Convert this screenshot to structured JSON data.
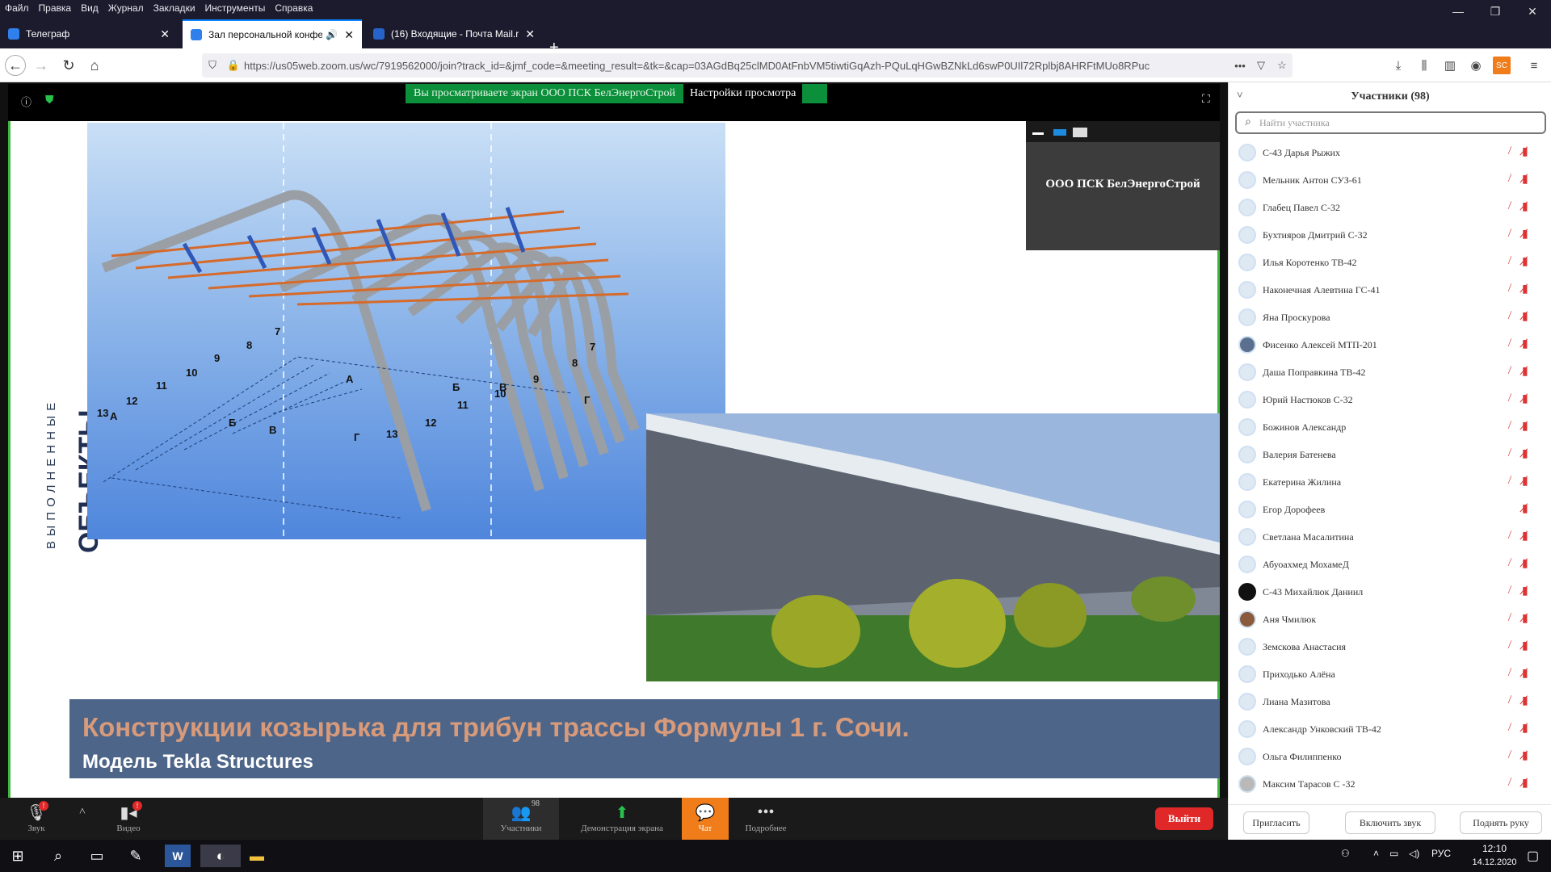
{
  "menu": [
    "Файл",
    "Правка",
    "Вид",
    "Журнал",
    "Закладки",
    "Инструменты",
    "Справка"
  ],
  "window_controls": {
    "minimize": "—",
    "maximize": "❐",
    "close": "✕"
  },
  "tabs": [
    {
      "label": "Телеграф",
      "favicon": "telegraph-icon"
    },
    {
      "label": "Зал персональной конфер",
      "favicon": "zoom-icon"
    },
    {
      "label": "(16) Входящие - Почта Mail.ru",
      "favicon": "mail-icon"
    }
  ],
  "new_tab": "+",
  "url": "https://us05web.zoom.us/wc/7919562000/join?track_id=&jmf_code=&meeting_result=&tk=&cap=03AGdBq25clMD0AtFnbVM5tiwtiGqAzh-PQuLqHGwBZNkLd6swP0UIl72Rplbj8AHRFtMUo8RPuc",
  "url_more": "•••",
  "meeting": {
    "share_banner": "Вы просматриваете экран ООО ПСК БелЭнергоСтрой",
    "view_settings": "Настройки просмотра",
    "presenter": "ООО ПСК БелЭнергоСтрой",
    "slide": {
      "vertical_small": "ВЫПОЛНЕННЫЕ",
      "vertical_big": "ОБЪЕКТЫ",
      "caption_title": "Конструкции козырька для трибун трассы Формулы 1 г. Сочи.",
      "caption_sub": "Модель Tekla Structures",
      "grid_labels": [
        "7",
        "8",
        "9",
        "10",
        "11",
        "12",
        "13",
        "А",
        "Б",
        "В",
        "Г",
        "13",
        "12",
        "11",
        "10",
        "9",
        "8",
        "7",
        "Б",
        "В",
        "Г",
        "А"
      ]
    }
  },
  "controls": {
    "audio": "Звук",
    "video": "Видео",
    "participants": "Участники",
    "participants_count": "98",
    "share": "Демонстрация экрана",
    "chat": "Чат",
    "more": "Подробнее",
    "leave": "Выйти",
    "audio_badge": "!",
    "video_badge": "!"
  },
  "panel": {
    "title": "Участники (98)",
    "search_placeholder": "Найти участника",
    "participants": [
      "С-43 Дарья Рыжих",
      "Мельник Антон СУЗ-61",
      "Глабец Павел С-32",
      "Бухтияров Дмитрий С-32",
      "Илья Коротенко ТВ-42",
      "Наконечная Алевтина ГС-41",
      "Яна Проскурова",
      "Фисенко Алексей МТП-201",
      "Даша Поправкина ТВ-42",
      "Юрий Настюков С-32",
      "Божинов Александр",
      "Валерия Батенева",
      "Екатерина Жилина",
      "Егор Дорофеев",
      "Светлана Масалитина",
      "Абуоахмед МохамеД",
      "С-43 Михайлюк Даниил",
      "Аня Чмилюк",
      "Земскова Анастасия",
      "Приходько Алёна",
      "Лиана Мазитова",
      "Александр Унковский ТВ-42",
      "Ольга Филиппенко",
      "Максим Тарасов С -32"
    ],
    "buttons": {
      "invite": "Пригласить",
      "unmute": "Включить звук",
      "raise_hand": "Поднять руку"
    }
  },
  "taskbar": {
    "lang": "РУС",
    "time": "12:10",
    "date": "14.12.2020"
  }
}
